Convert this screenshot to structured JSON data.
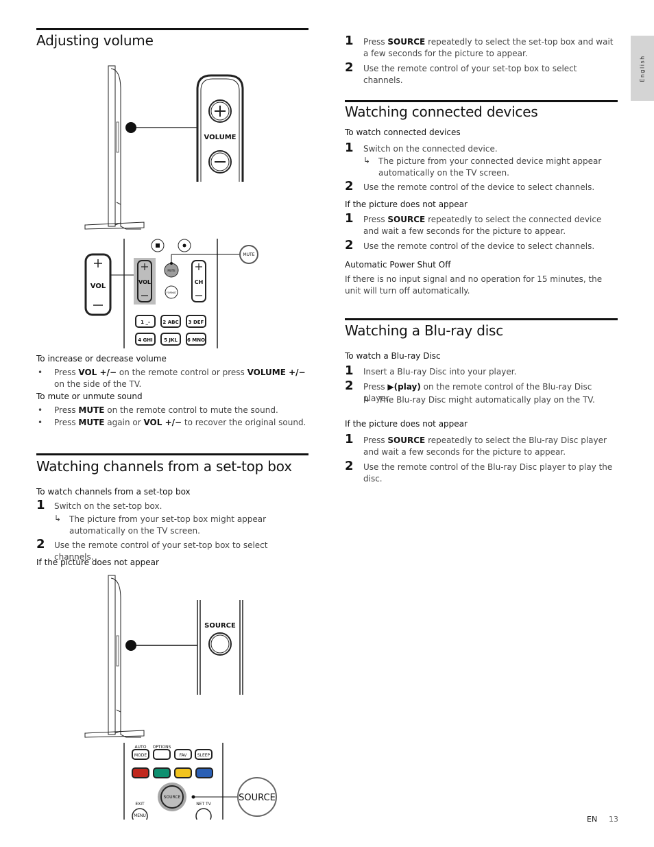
{
  "side_tab": {
    "label": "English"
  },
  "footer": {
    "lang": "EN",
    "page": "13"
  },
  "left": {
    "volume": {
      "title": "Adjusting volume",
      "illustration": {
        "side_button_label": "VOLUME",
        "remote_vol_label": "VOL",
        "remote_ch_label": "CH",
        "mute_label": "MUTE",
        "format_label": "FORMAT",
        "keypad": [
          "1 _-",
          "2 ABC",
          "3 DEF",
          "4 GHI",
          "5 JKL",
          "6 MNO"
        ]
      },
      "sub1": "To increase or decrease volume",
      "bullet1": {
        "pre": "Press ",
        "b1": "VOL +/−",
        "mid": " on the remote control or press ",
        "b2": "VOLUME +/−",
        "post": " on the side of the TV."
      },
      "sub2": "To mute or unmute sound",
      "bullet2": {
        "pre": "Press ",
        "b1": "MUTE",
        "post": " on the remote control to mute the sound."
      },
      "bullet3": {
        "pre": "Press ",
        "b1": "MUTE",
        "mid": " again or ",
        "b2": "VOL +/−",
        "post": " to recover the original sound."
      }
    },
    "settop": {
      "title": "Watching channels from a set-top box",
      "sub1": "To watch channels from a set-top box",
      "step1": {
        "n": "1",
        "text": "Switch on the set-top box."
      },
      "step1_result": "The picture from your set-top box might appear automatically on the TV screen.",
      "step2": {
        "n": "2",
        "text": "Use the remote control of your set-top box to select channels."
      },
      "sub2": "If the picture does not appear",
      "illustration": {
        "side_button_label": "SOURCE",
        "callout_label": "SOURCE",
        "remote_labels": {
          "auto": "AUTO",
          "mode": "MODE",
          "options": "OPTIONS",
          "fav": "FAV",
          "sleep": "SLEEP",
          "source": "SOURCE",
          "exit": "EXIT",
          "menu": "MENU",
          "nettv": "NET TV"
        },
        "color_keys": [
          "#c0281e",
          "#0e9070",
          "#f2c31d",
          "#2a5fb4"
        ]
      }
    }
  },
  "right": {
    "settop_cont": {
      "step1": {
        "n": "1",
        "pre": "Press ",
        "b": "SOURCE",
        "post": " repeatedly to select the set-top box and wait a few seconds for the picture to appear."
      },
      "step2": {
        "n": "2",
        "text": "Use the remote control of your set-top box to select channels."
      }
    },
    "connected": {
      "title": "Watching connected devices",
      "sub1": "To watch connected devices",
      "step1": {
        "n": "1",
        "text": "Switch on the connected device."
      },
      "step1_result": "The picture from your connected device might appear automatically on the TV screen.",
      "step2": {
        "n": "2",
        "text": "Use the remote control of the device to select channels."
      },
      "sub2": "If the picture does not appear",
      "step3": {
        "n": "1",
        "pre": "Press ",
        "b": "SOURCE",
        "post": " repeatedly to select the connected device and wait a few seconds for the picture to appear."
      },
      "step4": {
        "n": "2",
        "text": "Use the remote control of the device to select channels."
      },
      "sub3": "Automatic Power Shut Off",
      "note": "If there is no input signal and no operation for 15 minutes, the unit will turn off automatically."
    },
    "bluray": {
      "title": "Watching a Blu-ray disc",
      "sub1": "To watch a Blu-ray Disc",
      "step1": {
        "n": "1",
        "text": "Insert a Blu-ray Disc into your player."
      },
      "step2": {
        "n": "2",
        "pre": "Press ",
        "b": "▶(play)",
        "post": " on the remote control of the Blu-ray Disc player."
      },
      "step2_result": "The Blu-ray Disc might automatically play on the TV.",
      "sub2": "If the picture does not appear",
      "step3": {
        "n": "1",
        "pre": "Press ",
        "b": "SOURCE",
        "post": " repeatedly to select the Blu-ray Disc player and wait a few seconds for the picture to appear."
      },
      "step4": {
        "n": "2",
        "text": "Use the remote control of the Blu-ray Disc player to play the disc."
      }
    }
  }
}
